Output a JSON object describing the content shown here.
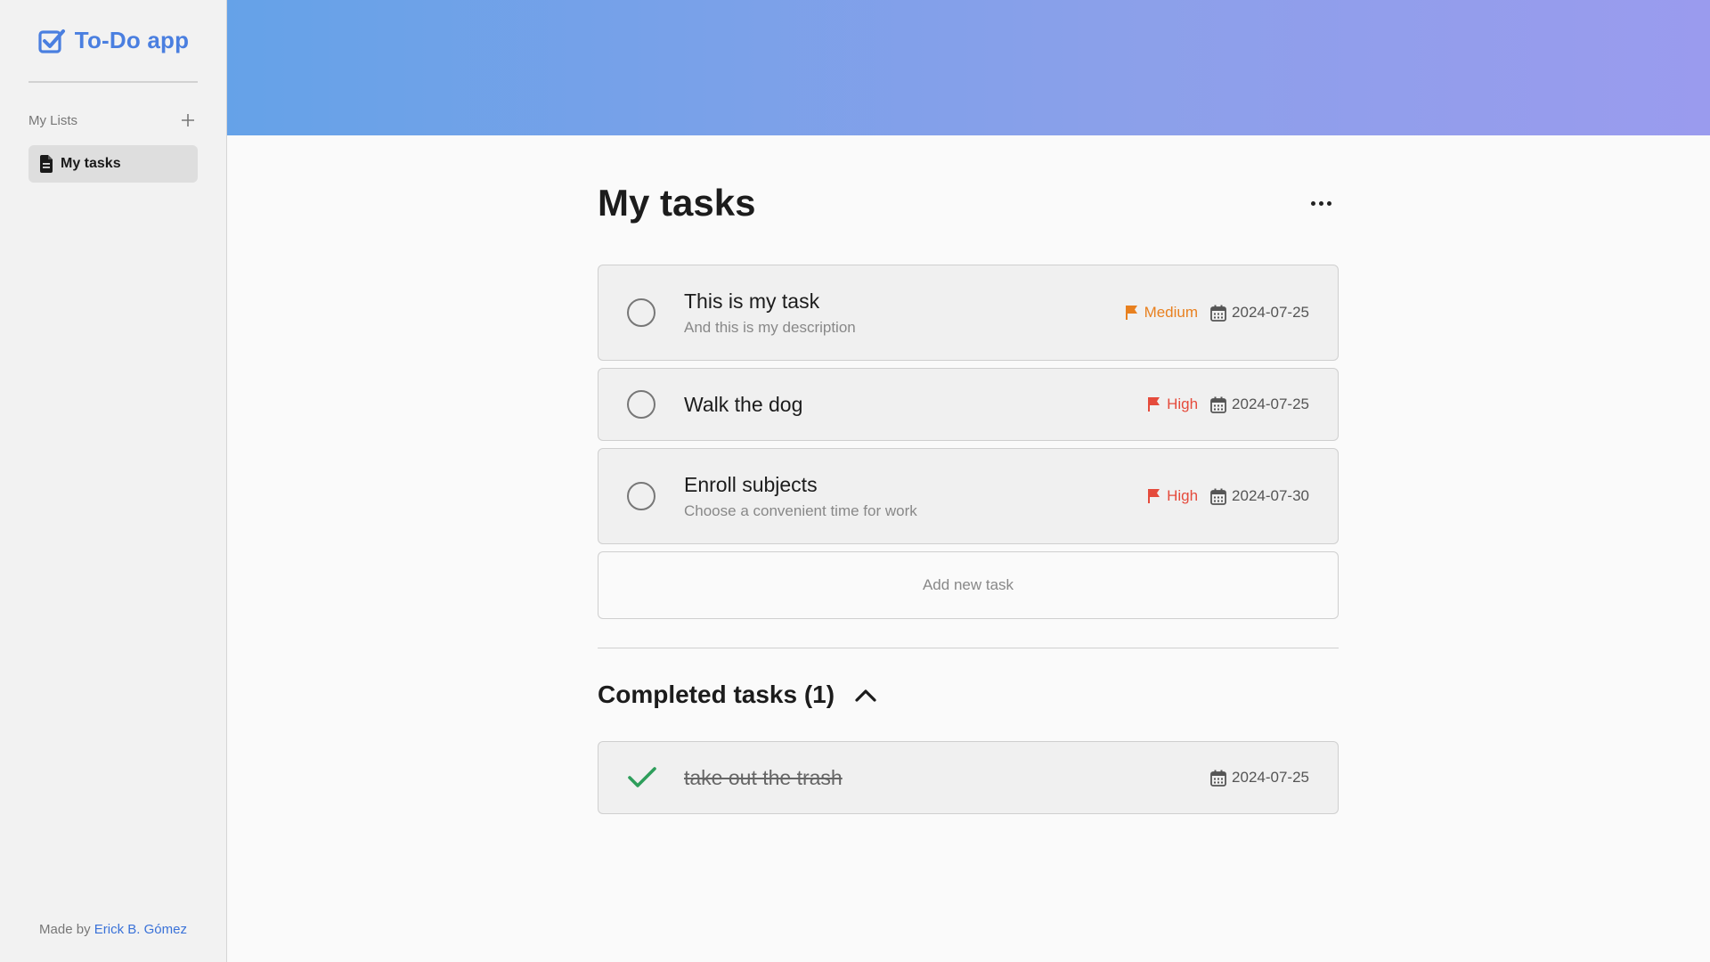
{
  "sidebar": {
    "brand": {
      "title": "To-Do app",
      "icon": "checkbox-icon"
    },
    "lists_label": "My Lists",
    "add_list_icon": "plus-icon",
    "items": [
      {
        "label": "My tasks",
        "icon": "document-icon",
        "selected": true
      }
    ],
    "footer": {
      "prefix": "Made by",
      "author": "Erick B. Gómez"
    }
  },
  "main": {
    "page_title": "My tasks",
    "more_icon": "ellipsis-icon",
    "tasks": [
      {
        "title": "This is my task",
        "description": "And this is my description",
        "priority": "Medium",
        "priority_color": "#e8801f",
        "due": "2024-07-25"
      },
      {
        "title": "Walk the dog",
        "description": "",
        "priority": "High",
        "priority_color": "#e54b3c",
        "due": "2024-07-25"
      },
      {
        "title": "Enroll subjects",
        "description": "Choose a convenient time for work",
        "priority": "High",
        "priority_color": "#e54b3c",
        "due": "2024-07-30"
      }
    ],
    "add_task_label": "Add new task",
    "completed": {
      "title": "Completed tasks (1)",
      "expanded": true,
      "tasks": [
        {
          "title": "take out the trash",
          "due": "2024-07-25"
        }
      ]
    }
  },
  "colors": {
    "accent": "#4a7fe0",
    "banner_start": "#65a2e8",
    "banner_end": "#9a9bee",
    "check_green": "#2e9e5b"
  }
}
